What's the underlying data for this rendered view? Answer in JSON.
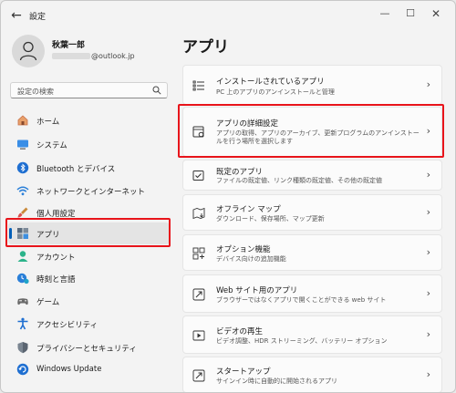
{
  "window": {
    "title": "設定",
    "back_glyph": "←",
    "minimize_glyph": "—",
    "maximize_glyph": "☐",
    "close_glyph": "✕"
  },
  "profile": {
    "name": "秋葉一郎",
    "email_suffix": "@outlook.jp"
  },
  "search": {
    "placeholder": "設定の検索"
  },
  "sidebar": {
    "items": [
      {
        "label": "ホーム",
        "icon": "home-icon",
        "selected": false
      },
      {
        "label": "システム",
        "icon": "system-icon",
        "selected": false
      },
      {
        "label": "Bluetooth とデバイス",
        "icon": "bluetooth-icon",
        "selected": false
      },
      {
        "label": "ネットワークとインターネット",
        "icon": "wifi-icon",
        "selected": false
      },
      {
        "label": "個人用設定",
        "icon": "brush-icon",
        "selected": false
      },
      {
        "label": "アプリ",
        "icon": "apps-icon",
        "selected": true
      },
      {
        "label": "アカウント",
        "icon": "account-icon",
        "selected": false
      },
      {
        "label": "時刻と言語",
        "icon": "clock-globe-icon",
        "selected": false
      },
      {
        "label": "ゲーム",
        "icon": "gamepad-icon",
        "selected": false
      },
      {
        "label": "アクセシビリティ",
        "icon": "accessibility-icon",
        "selected": false
      },
      {
        "label": "プライバシーとセキュリティ",
        "icon": "shield-icon",
        "selected": false
      },
      {
        "label": "Windows Update",
        "icon": "update-icon",
        "selected": false
      }
    ]
  },
  "main": {
    "title": "アプリ",
    "chevron": "›",
    "cards": [
      {
        "title": "インストールされているアプリ",
        "desc": "PC 上のアプリのアンインストールと管理",
        "icon": "list-icon"
      },
      {
        "title": "アプリの詳細設定",
        "desc": "アプリの取得、アプリのアーカイブ、更新プログラムのアンインストールを行う場所を選択します",
        "icon": "app-settings-icon"
      },
      {
        "title": "既定のアプリ",
        "desc": "ファイルの既定値、リンク種類の既定値、その他の既定値",
        "icon": "default-apps-icon"
      },
      {
        "title": "オフライン マップ",
        "desc": "ダウンロード、保存場所、マップ更新",
        "icon": "map-icon"
      },
      {
        "title": "オプション機能",
        "desc": "デバイス向けの追加機能",
        "icon": "optional-features-icon"
      },
      {
        "title": "Web サイト用のアプリ",
        "desc": "ブラウザーではなくアプリで開くことができる web サイト",
        "icon": "web-apps-icon"
      },
      {
        "title": "ビデオの再生",
        "desc": "ビデオ調整、HDR ストリーミング、バッテリー オプション",
        "icon": "video-icon"
      },
      {
        "title": "スタートアップ",
        "desc": "サインイン時に自動的に開始されるアプリ",
        "icon": "startup-icon"
      }
    ]
  },
  "colors": {
    "accent": "#005fb8",
    "annotation": "#e8141b"
  }
}
